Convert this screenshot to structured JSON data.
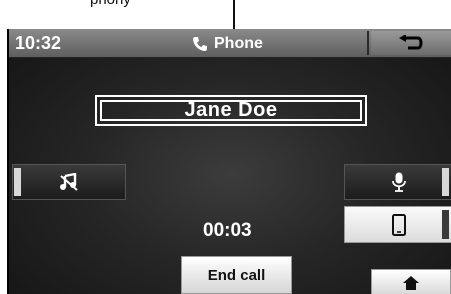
{
  "callout": {
    "text": "phony"
  },
  "status_bar": {
    "time": "10:32",
    "title": "Phone",
    "title_icon": "phone-handset-icon",
    "back_icon": "back-arrow-icon"
  },
  "call": {
    "contact_name": "Jane Doe",
    "duration": "00:03"
  },
  "buttons": {
    "music_icon": "music-mute-icon",
    "mic_icon": "microphone-icon",
    "handset_icon": "mobile-phone-icon",
    "end_call_label": "End call",
    "home_icon": "home-icon"
  },
  "colors": {
    "screen_background": "#262626",
    "status_bar": "#6f6f6f",
    "text": "#ffffff",
    "button_light": "#e6e6e6"
  }
}
